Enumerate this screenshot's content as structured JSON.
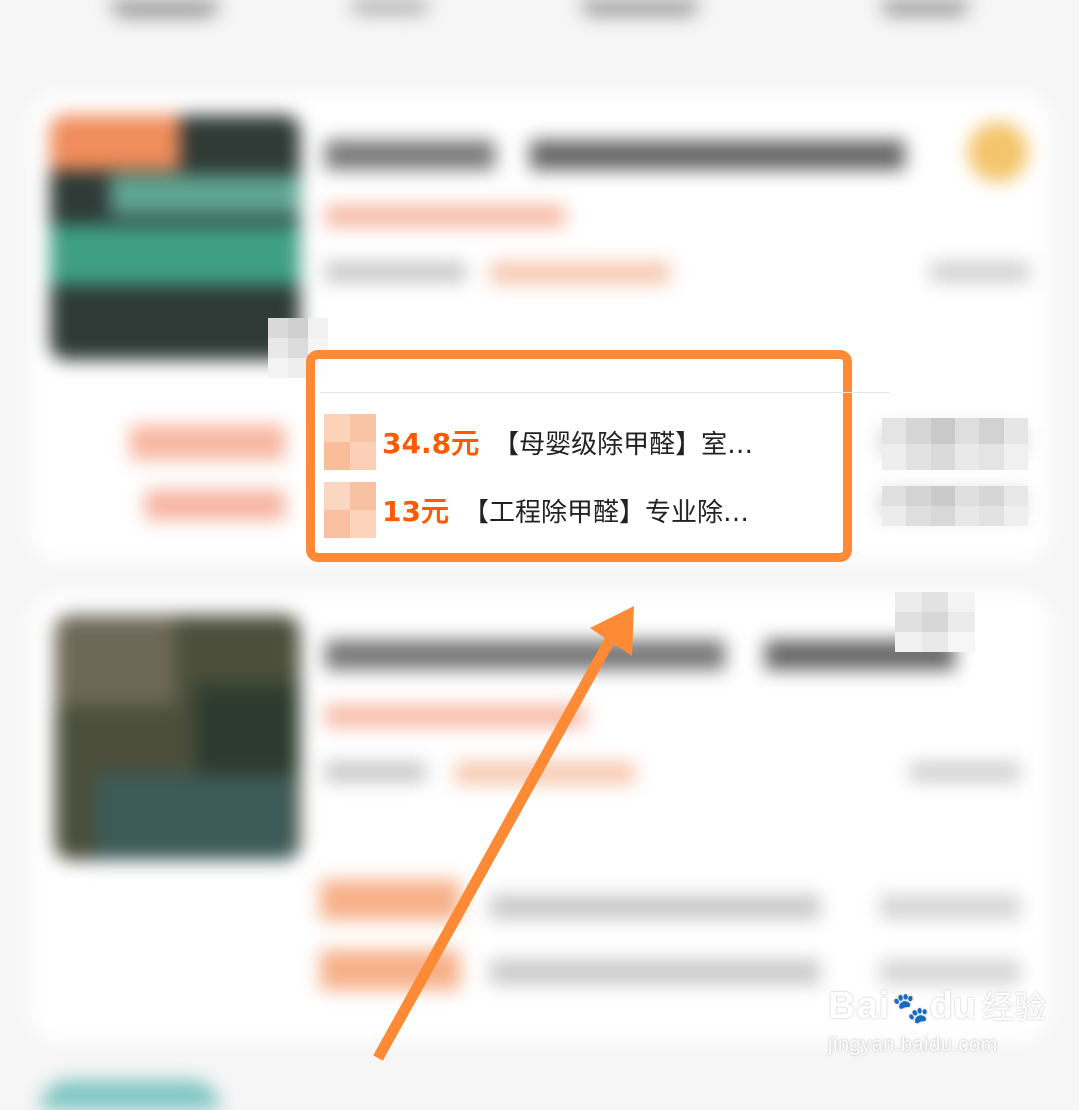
{
  "deals": [
    {
      "price": "34.8元",
      "title": "【母婴级除甲醛】室…"
    },
    {
      "price": "13元",
      "title": "【工程除甲醛】专业除…"
    }
  ],
  "watermark": {
    "brand": "Bai",
    "brand_suffix": "du",
    "product": "经验",
    "url": "jingyan.baidu.com"
  },
  "colors": {
    "accent": "#ff8a36",
    "price": "#ff5a00",
    "background": "#f6f6f6"
  }
}
